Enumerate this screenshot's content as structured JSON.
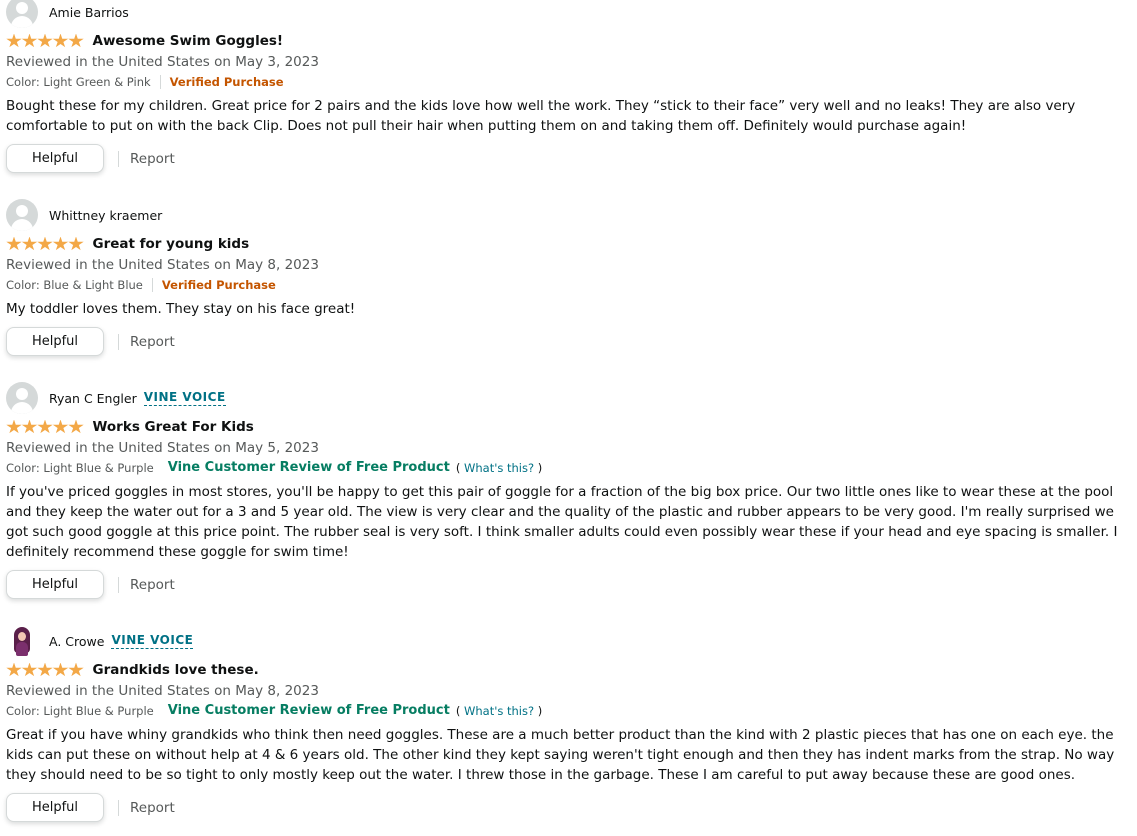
{
  "reviews": [
    {
      "reviewer": "Amie Barrios",
      "vine_badge": "",
      "title": "Awesome Swim Goggles!",
      "date": "Reviewed in the United States on May 3, 2023",
      "color": "Color: Light Green & Pink",
      "badge": "Verified Purchase",
      "body": "Bought these for my children. Great price for 2 pairs and the kids love how well the work. They “stick to their face” very well and no leaks! They are also very comfortable to put on with the back Clip. Does not pull their hair when putting them on and taking them off. Definitely would purchase again!",
      "rating": 5
    },
    {
      "reviewer": "Whittney kraemer",
      "vine_badge": "",
      "title": "Great for young kids",
      "date": "Reviewed in the United States on May 8, 2023",
      "color": "Color: Blue & Light Blue",
      "badge": "Verified Purchase",
      "body": "My toddler loves them. They stay on his face great!",
      "rating": 5
    },
    {
      "reviewer": "Ryan C Engler",
      "vine_badge": "VINE VOICE",
      "title": "Works Great For Kids",
      "date": "Reviewed in the United States on May 5, 2023",
      "color": "Color: Light Blue & Purple",
      "badge": "Vine Customer Review of Free Product",
      "whats_this": "What's this?",
      "body": "If you've priced goggles in most stores, you'll be happy to get this pair of goggle for a fraction of the big box price. Our two little ones like to wear these at the pool and they keep the water out for a 3 and 5 year old. The view is very clear and the quality of the plastic and rubber appears to be very good. I'm really surprised we got such good goggle at this price point. The rubber seal is very soft. I think smaller adults could even possibly wear these if your head and eye spacing is smaller. I definitely recommend these goggle for swim time!",
      "rating": 5
    },
    {
      "reviewer": "A. Crowe",
      "vine_badge": "VINE VOICE",
      "title": "Grandkids love these.",
      "date": "Reviewed in the United States on May 8, 2023",
      "color": "Color: Light Blue & Purple",
      "badge": "Vine Customer Review of Free Product",
      "whats_this": "What's this?",
      "body": "Great if you have whiny grandkids who think then need goggles. These are a much better product than the kind with 2 plastic pieces that has one on each eye. the kids can put these on without help at 4 & 6 years old. The other kind they kept saying weren't tight enough and then they has indent marks from the strap. No way they should need to be so tight to only mostly keep out the water. I threw those in the garbage. These I am careful to put away because these are good ones.",
      "rating": 5
    }
  ],
  "actions": {
    "helpful_label": "Helpful",
    "report_label": "Report"
  },
  "paren_open": "(",
  "paren_close": ")",
  "colors": {
    "star": "#f3a847",
    "verified": "#c45500",
    "vine_review": "#067d62",
    "link": "#007185"
  }
}
